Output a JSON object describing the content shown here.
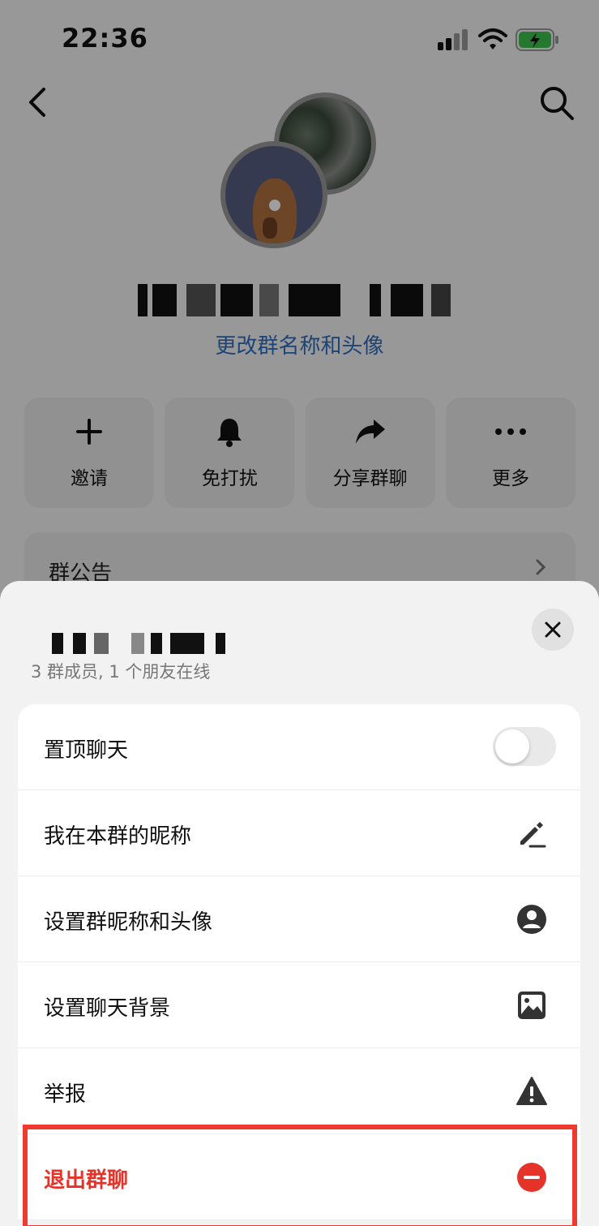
{
  "status_bar": {
    "time": "22:36"
  },
  "profile": {
    "change_link": "更改群名称和头像"
  },
  "quick_actions": [
    {
      "label": "邀请",
      "icon": "plus-icon"
    },
    {
      "label": "免打扰",
      "icon": "bell-icon"
    },
    {
      "label": "分享群聊",
      "icon": "share-icon"
    },
    {
      "label": "更多",
      "icon": "more-icon"
    }
  ],
  "notice": {
    "label": "群公告"
  },
  "sheet": {
    "subtitle": "3 群成员, 1 个朋友在线",
    "items": [
      {
        "label": "置顶聊天",
        "control": "toggle",
        "on": false
      },
      {
        "label": "我在本群的昵称",
        "icon": "pencil-icon"
      },
      {
        "label": "设置群昵称和头像",
        "icon": "person-circle-icon"
      },
      {
        "label": "设置聊天背景",
        "icon": "image-icon"
      },
      {
        "label": "举报",
        "icon": "warning-icon"
      },
      {
        "label": "退出群聊",
        "icon": "minus-circle-icon"
      }
    ]
  },
  "colors": {
    "link": "#2f6fbe",
    "danger": "#e5332a",
    "highlight": "#ee3b30"
  }
}
